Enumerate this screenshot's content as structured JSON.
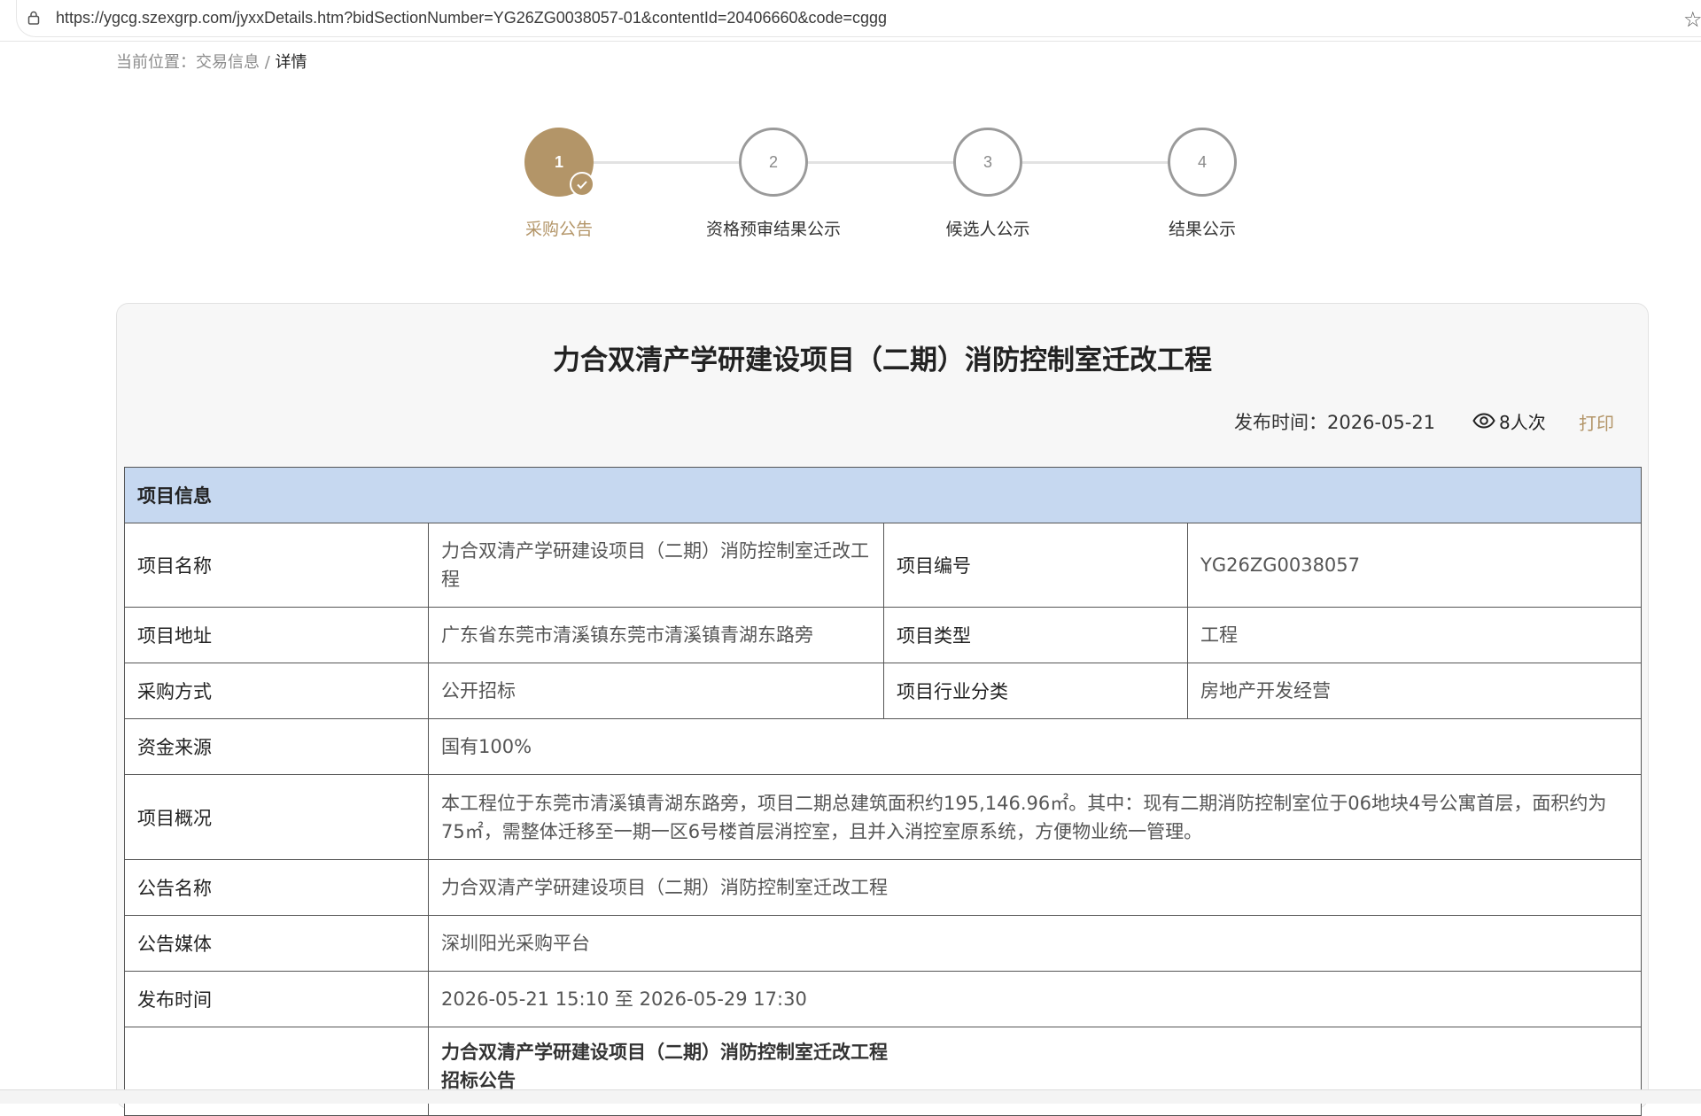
{
  "browser": {
    "url": "https://ygcg.szexgrp.com/jyxxDetails.htm?bidSectionNumber=YG26ZG0038057-01&contentId=20406660&code=cggg"
  },
  "breadcrumb": {
    "prefix": "当前位置：",
    "section": "交易信息",
    "separator": " / ",
    "current": "详情"
  },
  "steps": [
    {
      "number": "1",
      "label": "采购公告",
      "state": "active"
    },
    {
      "number": "2",
      "label": "资格预审结果公示",
      "state": "pending"
    },
    {
      "number": "3",
      "label": "候选人公示",
      "state": "pending"
    },
    {
      "number": "4",
      "label": "结果公示",
      "state": "pending"
    }
  ],
  "article": {
    "title": "力合双清产学研建设项目（二期）消防控制室迁改工程",
    "publish_label": "发布时间：",
    "publish_date": "2026-05-21",
    "views": "8人次",
    "print": "打印"
  },
  "info_table": {
    "section_header": "项目信息",
    "rows": {
      "name_label": "项目名称",
      "name_value": "力合双清产学研建设项目（二期）消防控制室迁改工程",
      "code_label": "项目编号",
      "code_value": "YG26ZG0038057",
      "address_label": "项目地址",
      "address_value": "广东省东莞市清溪镇东莞市清溪镇青湖东路旁",
      "type_label": "项目类型",
      "type_value": "工程",
      "method_label": "采购方式",
      "method_value": "公开招标",
      "industry_label": "项目行业分类",
      "industry_value": "房地产开发经营",
      "fund_label": "资金来源",
      "fund_value": "国有100%",
      "overview_label": "项目概况",
      "overview_value": "本工程位于东莞市清溪镇青湖东路旁，项目二期总建筑面积约195,146.96㎡。其中：现有二期消防控制室位于06地块4号公寓首层，面积约为75㎡，需整体迁移至一期一区6号楼首层消控室，且并入消控室原系统，方便物业统一管理。",
      "notice_name_label": "公告名称",
      "notice_name_value": "力合双清产学研建设项目（二期）消防控制室迁改工程",
      "media_label": "公告媒体",
      "media_value": "深圳阳光采购平台",
      "time_label": "发布时间",
      "time_value": "2026-05-21 15:10 至 2026-05-29 17:30",
      "content_line1": "力合双清产学研建设项目（二期）消防控制室迁改工程",
      "content_line2": "招标公告"
    }
  },
  "colors": {
    "accent": "#b39568",
    "table_header": "#c6d8f0",
    "panel_bg": "#f7f7f7"
  }
}
